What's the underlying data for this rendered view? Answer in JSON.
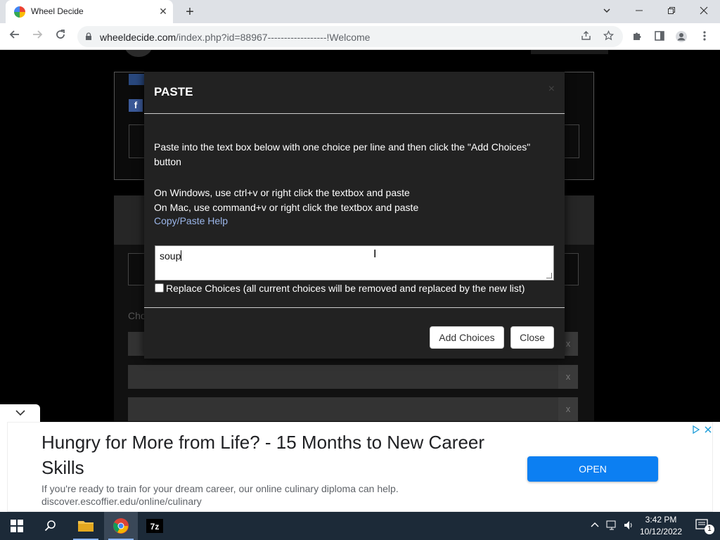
{
  "browser": {
    "tab_title": "Wheel Decide",
    "tab_close": "✕",
    "new_tab": "+",
    "url_host": "wheeldecide.com",
    "url_path": "/index.php?id=88967------------------!Welcome"
  },
  "page": {
    "bg_choices_label": "Cho",
    "remove_x": "x"
  },
  "modal": {
    "title": "PASTE",
    "close_x": "×",
    "instruction": "Paste into the text box below with one choice per line and then click the \"Add Choices\" button",
    "windows_hint": "On Windows, use ctrl+v or right click the textbox and paste",
    "mac_hint": "On Mac, use command+v or right click the textbox and paste",
    "help_link": "Copy/Paste Help",
    "textarea_value": "soup",
    "replace_label": "Replace Choices (all current choices will be removed and replaced by the new list)",
    "replace_checked": false,
    "add_button": "Add Choices",
    "close_button": "Close"
  },
  "ad": {
    "headline": "Hungry for More from Life? - 15 Months to New Career Skills",
    "description": "If you're ready to train for your dream career, our online culinary diploma can help.",
    "display_url": "discover.escoffier.edu/online/culinary",
    "cta": "OPEN"
  },
  "taskbar": {
    "time": "3:42 PM",
    "date": "10/12/2022",
    "notification_count": "1"
  },
  "colors": {
    "modal_bg": "#222222",
    "link": "#9ab5e8",
    "ad_cta": "#0c7ff2",
    "taskbar": "#1c2a38"
  }
}
